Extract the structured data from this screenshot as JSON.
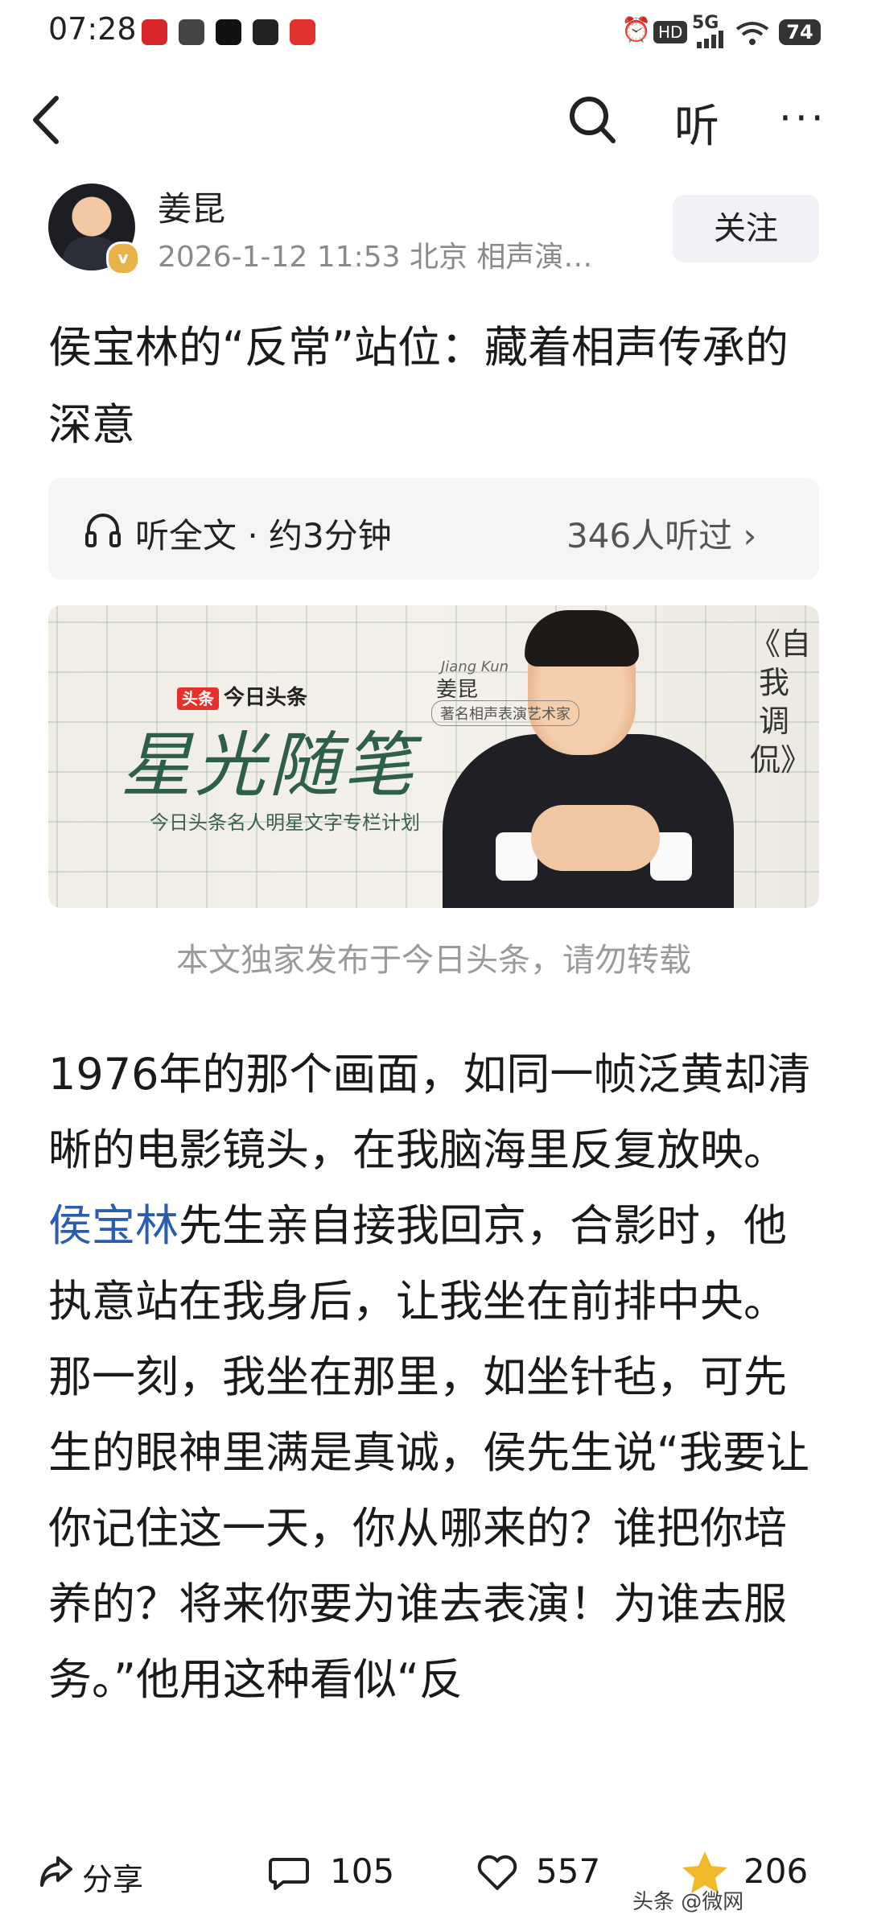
{
  "status_bar": {
    "time": "07:28",
    "network": "5G",
    "battery": "74",
    "app_icons": [
      "netease-news-icon",
      "link-app-icon",
      "tiktok-icon",
      "video-app-icon",
      "message-app-icon"
    ]
  },
  "nav": {
    "listen_label": "听",
    "more_label": "···"
  },
  "author": {
    "name": "姜昆",
    "meta": "2026-1-12 11:53 北京 相声演…",
    "verified_badge": "v",
    "follow_label": "关注"
  },
  "article": {
    "title": "侯宝林的“反常”站位：藏着相声传承的深意",
    "listen_full": "听全文 · 约3分钟",
    "listen_count": "346人听过 ›",
    "banner": {
      "logo_badge": "头条",
      "logo_text": "今日头条",
      "big_title": "星光随笔",
      "subtitle": "今日头条名人明星文字专栏计划",
      "name_en": "Jiang Kun",
      "name": "姜昆",
      "role": "著名相声表演艺术家",
      "vertical": "《自我调侃》"
    },
    "caption": "本文独家发布于今日头条，请勿转载",
    "body_before": "1976年的那个画面，如同一帧泛黄却清晰的电影镜头，在我脑海里反复放映。",
    "body_link": "侯宝林",
    "body_after": "先生亲自接我回京，合影时，他执意站在我身后，让我坐在前排中央。那一刻，我坐在那里，如坐针毡，可先生的眼神里满是真诚，侯先生说“我要让你记住这一天，你从哪来的？谁把你培养的？将来你要为谁去表演！为谁去服务。”他用这种看似“反"
  },
  "actions": {
    "share_label": "分享",
    "comments": "105",
    "likes": "557",
    "favorites": "206",
    "watermark": "头条 @微网"
  },
  "colors": {
    "link": "#2a5db0",
    "star": "#f2b82c",
    "follow_bg": "#f1f2f5"
  }
}
